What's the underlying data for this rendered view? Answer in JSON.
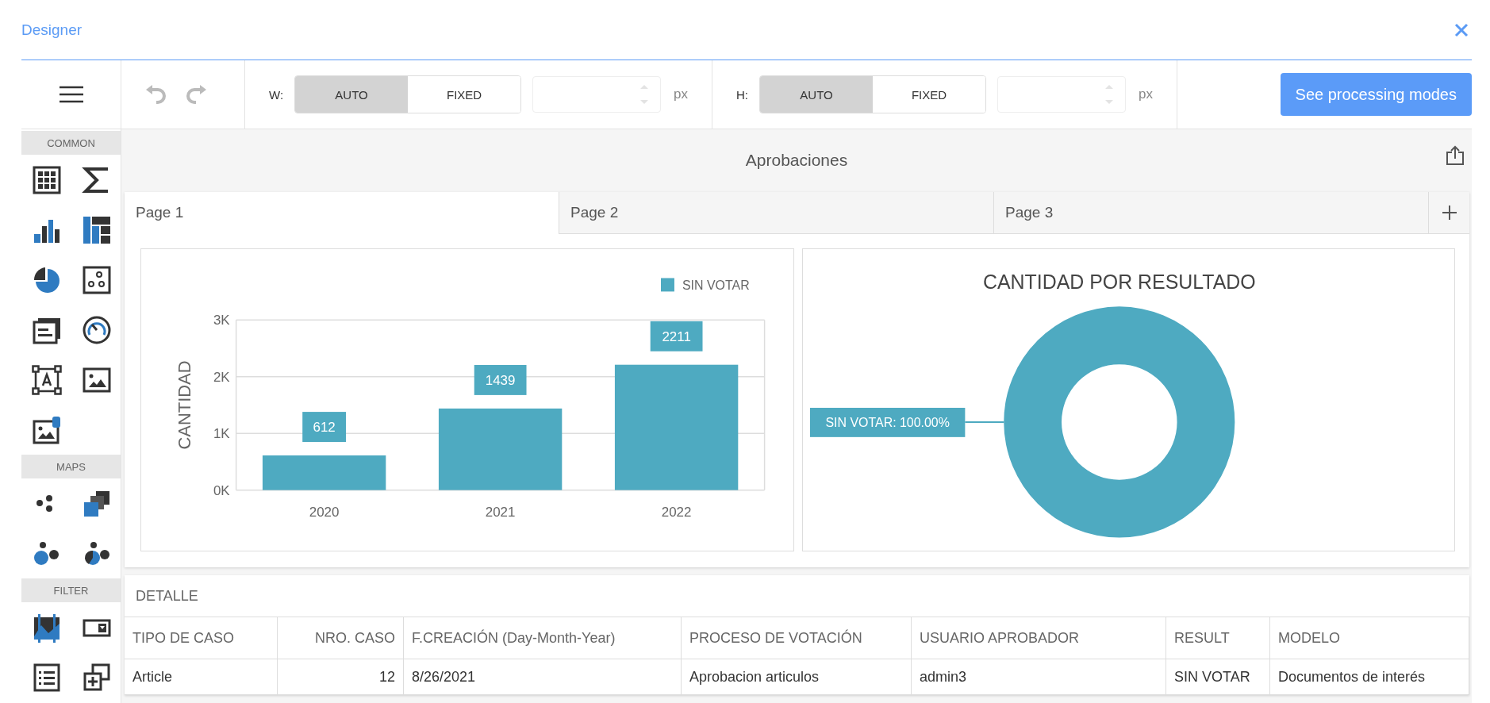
{
  "window": {
    "title": "Designer"
  },
  "sidebar": {
    "sections": [
      {
        "label": "COMMON"
      },
      {
        "label": "MAPS"
      },
      {
        "label": "FILTER"
      }
    ]
  },
  "toolbar": {
    "groups": [
      {
        "label": "W:",
        "options": [
          {
            "label": "AUTO",
            "selected": true
          },
          {
            "label": "FIXED",
            "selected": false
          }
        ],
        "unit": "px"
      },
      {
        "label": "H:",
        "options": [
          {
            "label": "AUTO",
            "selected": true
          },
          {
            "label": "FIXED",
            "selected": false
          }
        ],
        "unit": "px"
      }
    ],
    "button": "See processing modes"
  },
  "dashboard": {
    "title": "Aprobaciones",
    "tabs": [
      {
        "label": "Page 1",
        "selected": true
      },
      {
        "label": "Page 2",
        "selected": false
      },
      {
        "label": "Page 3",
        "selected": false
      }
    ],
    "bar_chart": {
      "chart_data": {
        "type": "bar",
        "ylabel": "CANTIDAD",
        "categories": [
          "2020",
          "2021",
          "2022"
        ],
        "series": [
          {
            "name": "SIN VOTAR",
            "color": "#4eaac1",
            "values": [
              612,
              1439,
              2211
            ]
          }
        ],
        "ylim": [
          0,
          3000
        ],
        "yticks": [
          {
            "value": 0,
            "label": "0K"
          },
          {
            "value": 1000,
            "label": "1K"
          },
          {
            "value": 2000,
            "label": "2K"
          },
          {
            "value": 3000,
            "label": "3K"
          }
        ],
        "data_labels": true
      }
    },
    "donut_chart": {
      "title": "CANTIDAD POR RESULTADO",
      "label": "SIN VOTAR: 100.00%"
    },
    "table": {
      "title": "DETALLE",
      "columns": [
        {
          "label": "TIPO DE CASO",
          "numeric": false
        },
        {
          "label": "NRO. CASO",
          "numeric": true
        },
        {
          "label": "F.CREACIÓN (Day-Month-Year)",
          "numeric": false
        },
        {
          "label": "PROCESO DE VOTACIÓN",
          "numeric": false
        },
        {
          "label": "USUARIO APROBADOR",
          "numeric": false
        },
        {
          "label": "RESULT",
          "numeric": false
        },
        {
          "label": "MODELO",
          "numeric": false
        }
      ],
      "rows": [
        [
          "Article",
          "12",
          "8/26/2021",
          "Aprobacion articulos",
          "admin3",
          "SIN VOTAR",
          "Documentos de interés"
        ]
      ]
    }
  }
}
